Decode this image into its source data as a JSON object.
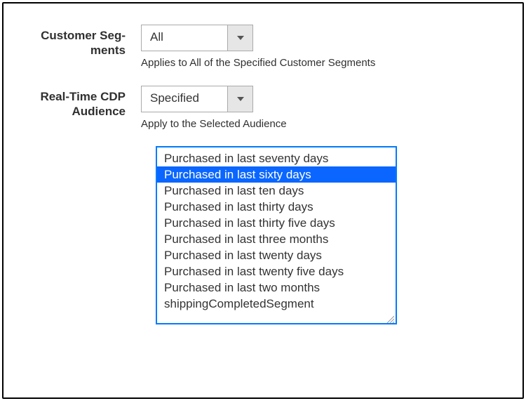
{
  "segments": {
    "label_line1": "Customer Seg-",
    "label_line2": "ments",
    "value": "All",
    "hint": "Applies to All of the Specified Customer Segments"
  },
  "audience": {
    "label_line1": "Real-Time CDP",
    "label_line2": "Audience",
    "value": "Specified",
    "hint": "Apply to the Selected Audience"
  },
  "listbox": {
    "selected_index": 1,
    "options": [
      "Purchased in last seventy days",
      "Purchased in last sixty days",
      "Purchased in last ten days",
      "Purchased in last thirty days",
      "Purchased in last thirty five days",
      "Purchased in last three months",
      "Purchased in last twenty days",
      "Purchased in last twenty five days",
      "Purchased in last two months",
      "shippingCompletedSegment"
    ]
  }
}
